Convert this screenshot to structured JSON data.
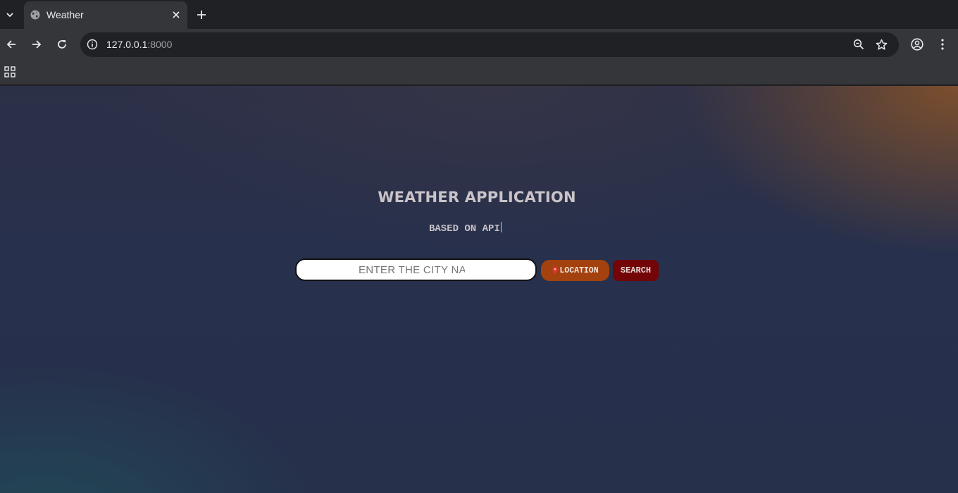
{
  "browser": {
    "tab": {
      "title": "Weather",
      "favicon": "globe-icon"
    },
    "address": {
      "host": "127.0.0.1",
      "port": ":8000"
    },
    "icons": {
      "tab_list": "chevron-down-icon",
      "close": "close-icon",
      "new_tab": "plus-icon",
      "back": "back-arrow-icon",
      "forward": "forward-arrow-icon",
      "reload": "reload-icon",
      "site_info": "info-icon",
      "zoom": "zoom-out-icon",
      "bookmark": "star-icon",
      "profile": "profile-icon",
      "menu": "kebab-menu-icon",
      "apps": "apps-grid-icon"
    }
  },
  "page": {
    "title": "WEATHER APPLICATION",
    "subtitle": "BASED ON API",
    "search": {
      "placeholder": "ENTER THE CITY NAME",
      "value": ""
    },
    "location_button": {
      "icon": "map-pin-icon",
      "label": "LOCATION"
    },
    "search_button": {
      "label": "SEARCH"
    },
    "colors": {
      "location_button": "#a3420f",
      "search_button": "#730508",
      "background": "#26304b"
    }
  }
}
